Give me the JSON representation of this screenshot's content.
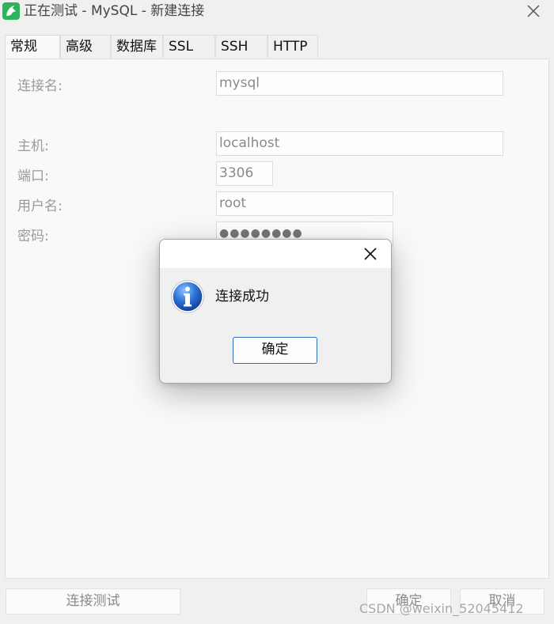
{
  "window": {
    "title": "正在测试 - MySQL - 新建连接",
    "logo_icon": "navicat-dolphin-icon",
    "close_icon": "close-icon"
  },
  "tabs": [
    {
      "label": "常规",
      "active": true
    },
    {
      "label": "高级",
      "active": false
    },
    {
      "label": "数据库",
      "active": false
    },
    {
      "label": "SSL",
      "active": false
    },
    {
      "label": "SSH",
      "active": false
    },
    {
      "label": "HTTP",
      "active": false
    }
  ],
  "form": {
    "connection_name": {
      "label": "连接名:",
      "value": "mysql"
    },
    "host": {
      "label": "主机:",
      "value": "localhost"
    },
    "port": {
      "label": "端口:",
      "value": "3306"
    },
    "username": {
      "label": "用户名:",
      "value": "root"
    },
    "password": {
      "label": "密码:",
      "value": "●●●●●●●●"
    }
  },
  "buttons": {
    "test_connection": "连接测试",
    "ok": "确定",
    "cancel": "取消"
  },
  "watermark": "CSDN @weixin_52045412",
  "dialog": {
    "message": "连接成功",
    "ok_label": "确定",
    "icon": "info-icon"
  },
  "colors": {
    "accent_border": "#2f6fb3",
    "logo_green": "#2db35a",
    "info_blue": "#1f5fbf"
  }
}
